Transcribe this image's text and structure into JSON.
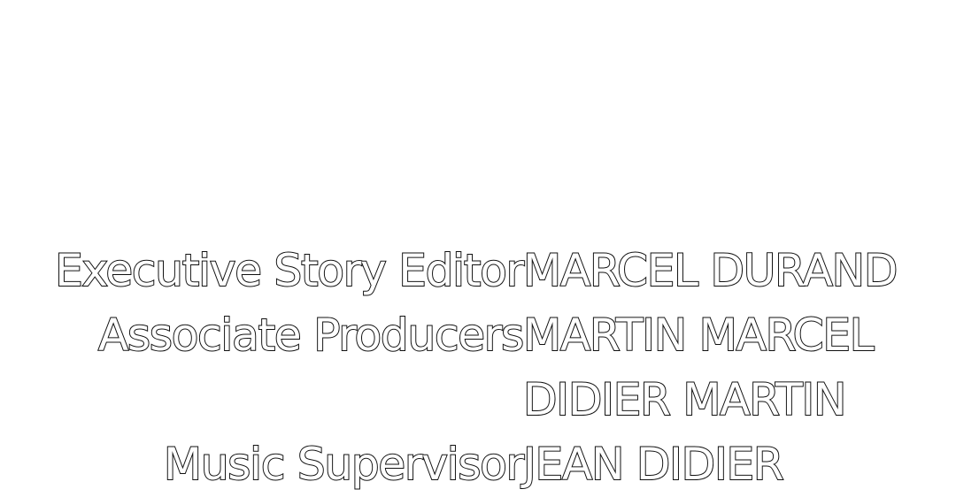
{
  "credits": [
    {
      "role": "Executive Story Editor",
      "names": [
        "MARCEL DURAND"
      ]
    },
    {
      "role": "Associate Producers",
      "names": [
        "MARTIN MARCEL",
        "DIDIER MARTIN"
      ]
    },
    {
      "role": "Music Supervisor",
      "names": [
        "JEAN DIDIER"
      ]
    }
  ],
  "colors": {
    "background": "#ffffff",
    "text_fill": "#ffffff",
    "text_outline": "#111111"
  }
}
